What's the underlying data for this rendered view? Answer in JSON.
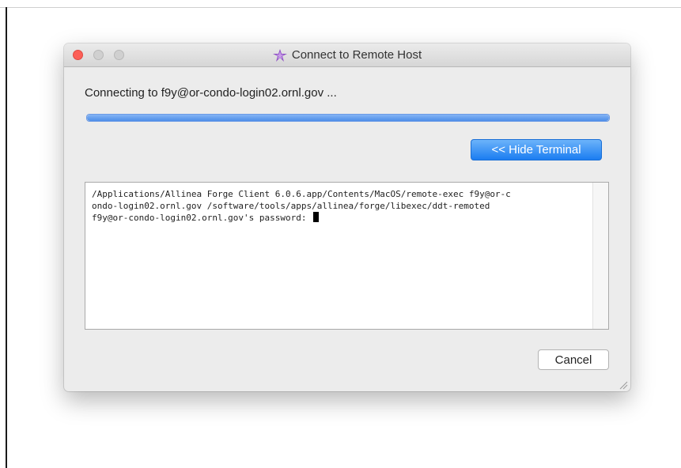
{
  "window": {
    "title": "Connect to Remote Host",
    "icon": "allinea-forge-icon"
  },
  "status": {
    "text": "Connecting to f9y@or-condo-login02.ornl.gov ..."
  },
  "progress": {
    "fraction": 1.0,
    "accent": "#4d8ee8"
  },
  "buttons": {
    "hide_terminal": "<< Hide Terminal",
    "cancel": "Cancel"
  },
  "terminal": {
    "lines": [
      "/Applications/Allinea Forge Client 6.0.6.app/Contents/MacOS/remote-exec f9y@or-c",
      "ondo-login02.ornl.gov /software/tools/apps/allinea/forge/libexec/ddt-remoted",
      "f9y@or-condo-login02.ornl.gov's password: "
    ]
  }
}
